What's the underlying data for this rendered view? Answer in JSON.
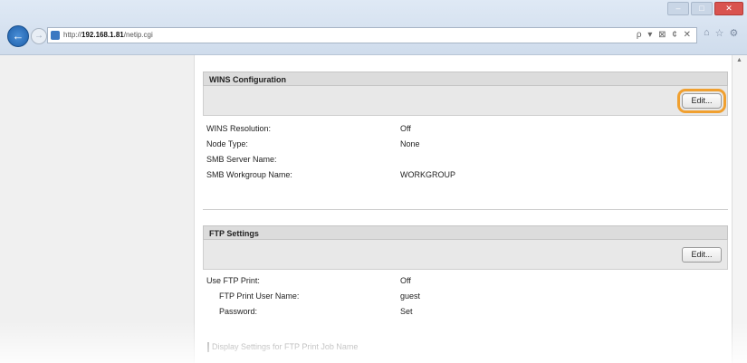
{
  "browser": {
    "url_prefix": "http://",
    "url_host": "192.168.1.81",
    "url_path": "/netip.cgi",
    "address_actions": "ρ ▾ ⊠ ¢ ✕",
    "window_buttons": [
      "‒",
      "□",
      "✕"
    ]
  },
  "wins": {
    "title": "WINS Configuration",
    "edit_label": "Edit...",
    "rows": [
      {
        "label": "WINS Resolution:",
        "value": "Off"
      },
      {
        "label": "Node Type:",
        "value": "None"
      },
      {
        "label": "SMB Server Name:",
        "value": ""
      },
      {
        "label": "SMB Workgroup Name:",
        "value": "WORKGROUP"
      }
    ]
  },
  "ftp": {
    "title": "FTP Settings",
    "edit_label": "Edit...",
    "rows": [
      {
        "label": "Use FTP Print:",
        "value": "Off"
      },
      {
        "label": "FTP Print User Name:",
        "value": "guest"
      },
      {
        "label": "Password:",
        "value": "Set"
      }
    ],
    "footer_link": "Display Settings for FTP Print Job Name"
  },
  "colors": {
    "highlight": "#f0a030",
    "section_header": "#dcdcdc",
    "close_button": "#d9534f"
  }
}
